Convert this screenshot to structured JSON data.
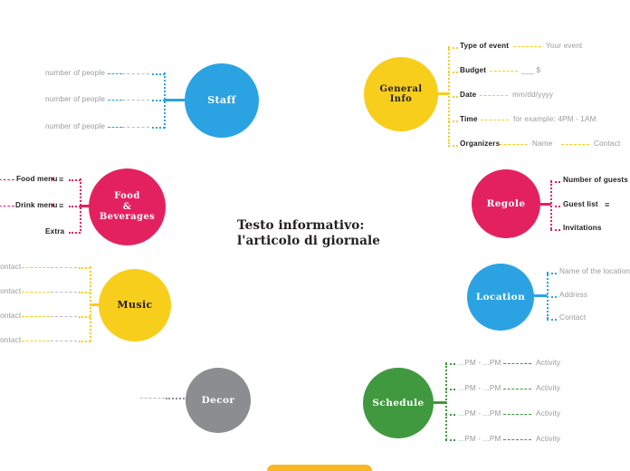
{
  "document": {
    "headline": "Testo informativo: l'articolo di giornale"
  },
  "colors": {
    "blue": "#2BA3E3",
    "pink": "#E4215F",
    "yellow": "#F8CE1C",
    "green": "#40993F",
    "grey": "#8B8D90",
    "text_grey": "#9a9a9a",
    "text_dark": "#231f20",
    "white": "#ffffff",
    "bottom_bar": "#F9B723"
  },
  "nodes": {
    "staff": {
      "label": "Staff",
      "color": "#2BA3E3",
      "text_color": "#ffffff",
      "branches": [
        {
          "label": "number of people"
        },
        {
          "label": "number of people"
        },
        {
          "label": "number of people"
        }
      ]
    },
    "food_beverages": {
      "label": "Food\n&\nBeverages",
      "color": "#E4215F",
      "text_color": "#ffffff",
      "branches": [
        {
          "label": "Food menu",
          "icon": "list-icon"
        },
        {
          "label": "Drink menu",
          "icon": "list-icon"
        },
        {
          "label": "Extra"
        }
      ]
    },
    "music": {
      "label": "Music",
      "color": "#F8CE1C",
      "text_color": "#231f20",
      "branches": [
        {
          "label": "Contact"
        },
        {
          "label": "Contact"
        },
        {
          "label": "Contact"
        },
        {
          "label": "Contact"
        }
      ]
    },
    "decor": {
      "label": "Decor",
      "color": "#8B8D90",
      "text_color": "#ffffff",
      "branches": []
    },
    "general_info": {
      "label": "General\nInfo",
      "color": "#F8CE1C",
      "text_color": "#231f20",
      "branches": [
        {
          "label": "Type of event",
          "value": "Your event"
        },
        {
          "label": "Budget",
          "value": "___ $"
        },
        {
          "label": "Date",
          "value": "mm/dd/yyyy"
        },
        {
          "label": "Time",
          "value": "for example: 4PM - 1AM"
        },
        {
          "label": "Organizers",
          "value": "Name",
          "value2": "Contact"
        }
      ]
    },
    "regole": {
      "label": "Regole",
      "color": "#E4215F",
      "text_color": "#ffffff",
      "branches": [
        {
          "label": "Number of guests"
        },
        {
          "label": "Guest list",
          "icon": "list-icon"
        },
        {
          "label": "Invitations"
        }
      ]
    },
    "location": {
      "label": "Location",
      "color": "#2BA3E3",
      "text_color": "#ffffff",
      "branches": [
        {
          "label": "Name of the location"
        },
        {
          "label": "Address"
        },
        {
          "label": "Contact"
        }
      ]
    },
    "schedule": {
      "label": "Schedule",
      "color": "#40993F",
      "text_color": "#ffffff",
      "branches": [
        {
          "label": "...PM - ...PM",
          "value": "Activity"
        },
        {
          "label": "...PM - ...PM",
          "value": "Activity"
        },
        {
          "label": "...PM - ...PM",
          "value": "Activity"
        },
        {
          "label": "...PM - ...PM",
          "value": "Activity"
        }
      ]
    }
  }
}
